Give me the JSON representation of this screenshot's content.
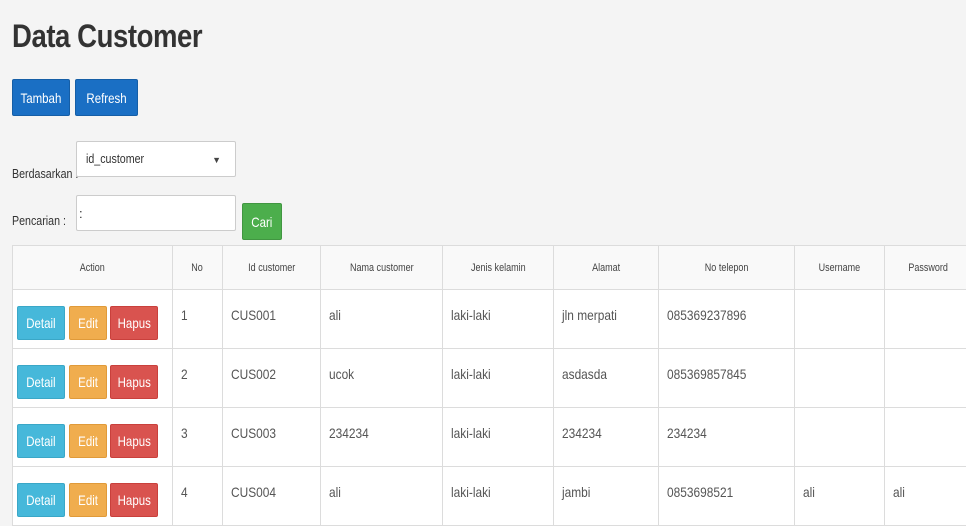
{
  "page": {
    "title": "Data Customer"
  },
  "toolbar": {
    "tambah_label": "Tambah",
    "refresh_label": "Refresh"
  },
  "filter": {
    "berdasarkan_label": "Berdasarkan :",
    "selected_field": "id_customer",
    "pencarian_label": "Pencarian    :",
    "search_value": "",
    "search_colon": ":",
    "cari_label": "Cari"
  },
  "table": {
    "headers": [
      "Action",
      "No",
      "Id customer",
      "Nama customer",
      "Jenis kelamin",
      "Alamat",
      "No telepon",
      "Username",
      "Password"
    ],
    "action_labels": {
      "detail": "Detail",
      "edit": "Edit",
      "hapus": "Hapus"
    },
    "rows": [
      {
        "no": "1",
        "id": "CUS001",
        "nama": "ali",
        "jenis": "laki-laki",
        "alamat": "jln merpati",
        "telepon": "085369237896",
        "username": "",
        "password": ""
      },
      {
        "no": "2",
        "id": "CUS002",
        "nama": "ucok",
        "jenis": "laki-laki",
        "alamat": "asdasda",
        "telepon": "085369857845",
        "username": "",
        "password": ""
      },
      {
        "no": "3",
        "id": "CUS003",
        "nama": "234234",
        "jenis": "laki-laki",
        "alamat": "234234",
        "telepon": "234234",
        "username": "",
        "password": ""
      },
      {
        "no": "4",
        "id": "CUS004",
        "nama": "ali",
        "jenis": "laki-laki",
        "alamat": "jambi",
        "telepon": "0853698521",
        "username": "ali",
        "password": "ali"
      }
    ]
  },
  "colors": {
    "primary": "#1a6fc4",
    "success": "#4cae4c",
    "info": "#46b8da",
    "warning": "#f0ad4e",
    "danger": "#d9534f"
  }
}
